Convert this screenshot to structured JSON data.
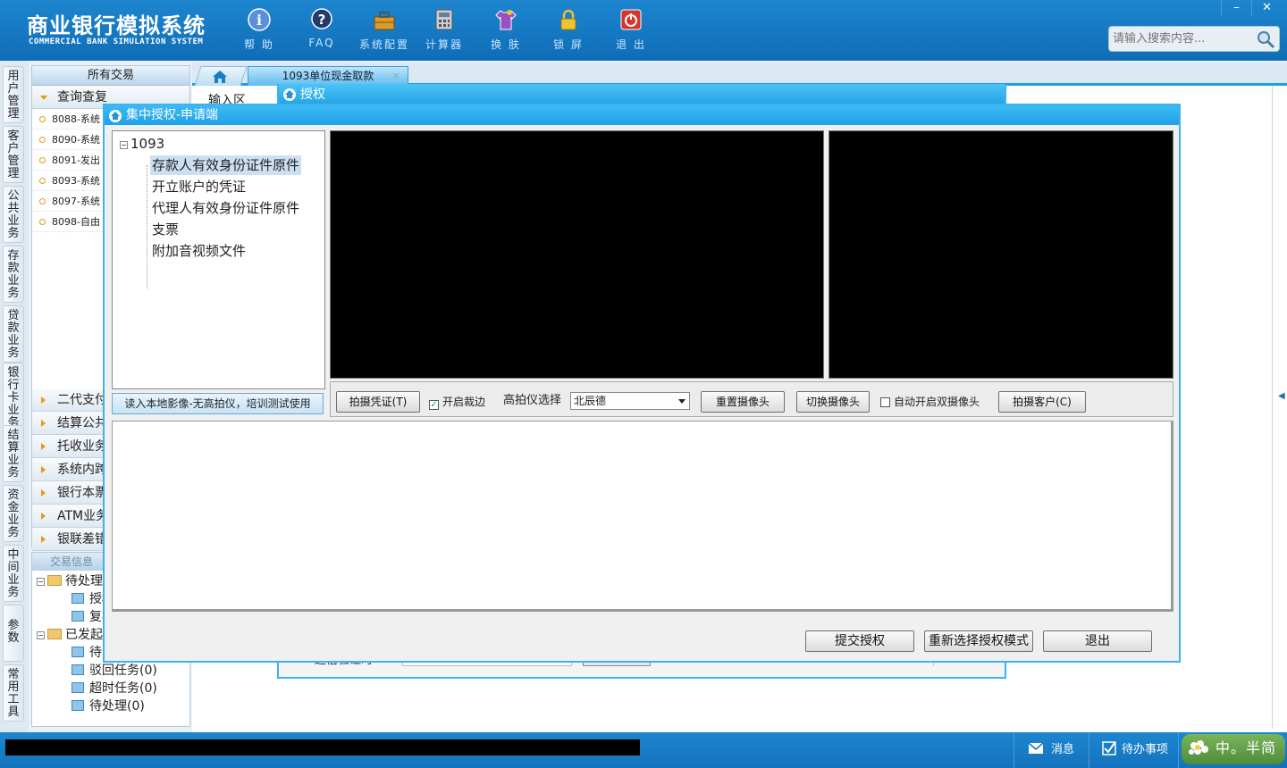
{
  "app": {
    "title_cn": "商业银行模拟系统",
    "title_en": "COMMERCIAL BANK SIMULATION SYSTEM",
    "brand_color": "#1478c2",
    "accent_color": "#22a3e6"
  },
  "toolbar": [
    {
      "label": "帮 助",
      "icon": "help-icon"
    },
    {
      "label": "FAQ",
      "icon": "faq-icon"
    },
    {
      "label": "系统配置",
      "icon": "toolbox-icon"
    },
    {
      "label": "计算器",
      "icon": "calculator-icon"
    },
    {
      "label": "换 肤",
      "icon": "shirt-icon"
    },
    {
      "label": "锁 屏",
      "icon": "lock-icon"
    },
    {
      "label": "退 出",
      "icon": "power-icon"
    }
  ],
  "window_controls": {
    "minimize": "–",
    "close": "✕"
  },
  "search": {
    "placeholder": "请输入搜索内容..."
  },
  "left_tabs": [
    "用户管理",
    "客户管理",
    "公共业务",
    "存款业务",
    "贷款业务",
    "银行卡业务",
    "结算业务",
    "资金业务",
    "中间业务",
    "参数",
    "常用工具"
  ],
  "tx_panel": {
    "header": "所有交易",
    "open_group": "查询查复",
    "items": [
      "8088-系统",
      "8090-系统",
      "8091-发出",
      "8093-系统",
      "8097-系统",
      "8098-自由"
    ],
    "groups": [
      "二代支付",
      "结算公共",
      "托收业务",
      "系统内跨",
      "银行本票",
      "ATM业务",
      "银联差错"
    ]
  },
  "info_panel": {
    "header": "交易信息",
    "pending": "待处理",
    "pending_children": [
      "授权",
      "复核"
    ],
    "initiated": "已发起",
    "initiated_children": [
      "待",
      "驳回任务(0)",
      "超时任务(0)",
      "待处理(0)"
    ]
  },
  "tabs": {
    "home_icon": "home-icon",
    "active_tab": "1093单位现金取款",
    "close": "×"
  },
  "behind": {
    "input_area": "输入区",
    "auth_title": "授权",
    "footer_label": "超信验证时"
  },
  "modal": {
    "title": "集中授权-申请端",
    "tree": {
      "root": "1093",
      "nodes": [
        "存款人有效身份证件原件",
        "开立账户的凭证",
        "代理人有效身份证件原件",
        "支票",
        "附加音视频文件"
      ],
      "selected_index": 0
    },
    "load_local_button": "读入本地影像-无高拍仪，培训测试使用",
    "capture_voucher_button": "拍摄凭证(T)",
    "enable_crop": {
      "label": "开启裁边",
      "checked": true
    },
    "scanner_label": "高拍仪选择",
    "scanner_value": "北辰德",
    "reset_camera_button": "重置摄像头",
    "switch_camera_button": "切换摄像头",
    "auto_dual_camera": {
      "label": "自动开启双摄像头",
      "checked": false
    },
    "capture_customer_button": "拍摄客户(C)",
    "submit_button": "提交授权",
    "reselect_button": "重新选择授权模式",
    "exit_button": "退出"
  },
  "statusbar": {
    "message_label": "消息",
    "todo_label": "待办事项",
    "ime_text": "中。半简"
  }
}
